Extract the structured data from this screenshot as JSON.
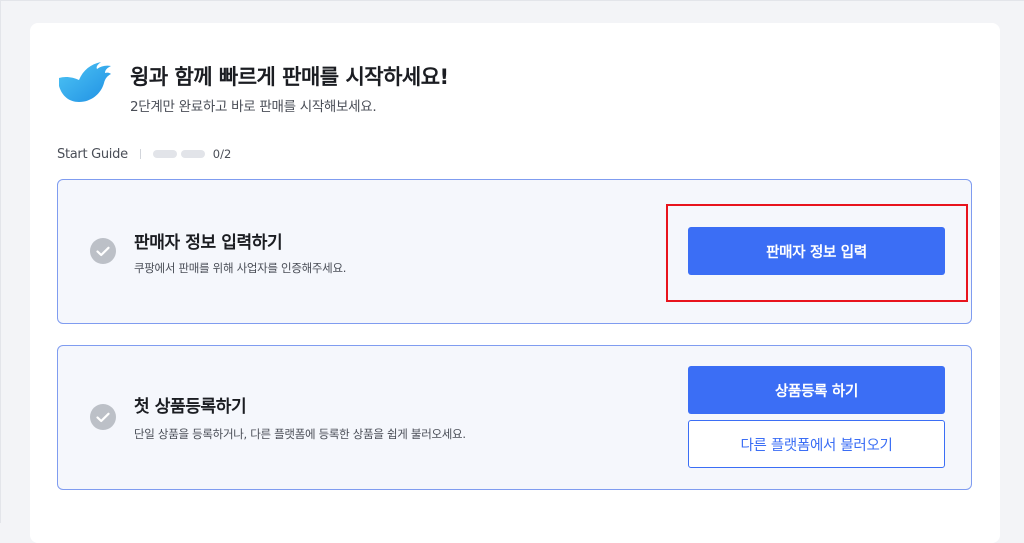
{
  "header": {
    "title": "윙과 함께 빠르게 판매를 시작하세요!",
    "subtitle": "2단계만 완료하고 바로 판매를 시작해보세요."
  },
  "guide": {
    "label": "Start Guide",
    "completed": 0,
    "total": 2,
    "count_text": "0/2"
  },
  "steps": [
    {
      "title": "판매자 정보 입력하기",
      "description": "쿠팡에서 판매를 위해 사업자를 인증해주세요.",
      "buttons": [
        {
          "label": "판매자 정보 입력",
          "style": "primary"
        }
      ]
    },
    {
      "title": "첫 상품등록하기",
      "description": "단일 상품을 등록하거나, 다른 플랫폼에 등록한 상품을 쉽게 불러오세요.",
      "buttons": [
        {
          "label": "상품등록 하기",
          "style": "primary"
        },
        {
          "label": "다른 플랫폼에서 불러오기",
          "style": "outline"
        }
      ]
    }
  ],
  "colors": {
    "accent": "#3b6ef5",
    "step_border": "#7f9cf0",
    "step_background": "#f5f7fc",
    "check_circle": "#bcc0c7",
    "highlight": "#e8141d"
  },
  "icons": {
    "logo": "wing-logo-icon",
    "step_check": "check-circle-icon"
  }
}
